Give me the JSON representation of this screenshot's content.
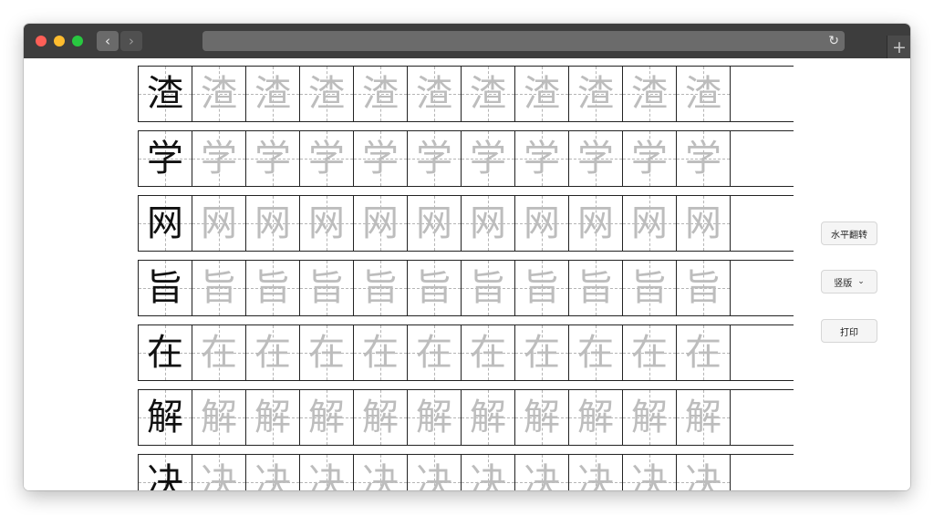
{
  "browser": {
    "back_icon": "‹",
    "forward_icon": "›",
    "reload_icon": "↻",
    "new_tab_icon": "+"
  },
  "characters": [
    "渣",
    "学",
    "网",
    "旨",
    "在",
    "解",
    "决"
  ],
  "copies_per_row": 10,
  "controls": {
    "flip_label": "水平翻转",
    "layout_select_value": "竖版",
    "print_label": "打印"
  },
  "colors": {
    "model_char": "#111111",
    "trace_char": "#bdbdbd",
    "grid_guide": "#b5b5b5"
  }
}
